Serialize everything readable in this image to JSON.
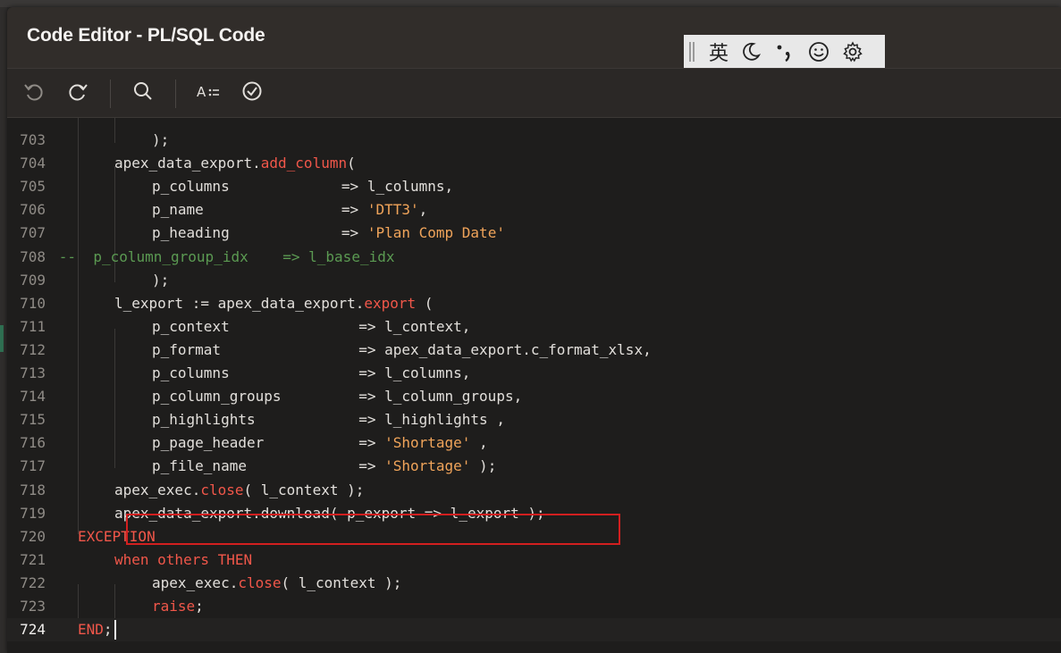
{
  "dialog": {
    "title": "Code Editor - PL/SQL Code"
  },
  "ime": {
    "mode_char": "英"
  },
  "toolbar": {
    "buttons": [
      {
        "name": "undo-button",
        "icon": "undo-icon"
      },
      {
        "name": "redo-button",
        "icon": "redo-icon"
      },
      {
        "name": "search-button",
        "icon": "search-icon"
      },
      {
        "name": "autocomplete-button",
        "icon": "autocomplete-icon"
      },
      {
        "name": "validate-button",
        "icon": "check-circle-icon"
      }
    ]
  },
  "editor": {
    "current_line": 724,
    "highlighted_line": 715,
    "lines": [
      {
        "n": "703",
        "indent": 3,
        "parts": [
          {
            "t": ");",
            "c": ""
          }
        ]
      },
      {
        "n": "704",
        "indent": 2,
        "parts": [
          {
            "t": "apex_data_export.",
            "c": ""
          },
          {
            "t": "add_column",
            "c": "fn"
          },
          {
            "t": "(",
            "c": ""
          }
        ]
      },
      {
        "n": "705",
        "indent": 3,
        "parts": [
          {
            "t": "p_columns             => l_columns,",
            "c": ""
          }
        ]
      },
      {
        "n": "706",
        "indent": 3,
        "parts": [
          {
            "t": "p_name                => ",
            "c": ""
          },
          {
            "t": "'DTT3'",
            "c": "str"
          },
          {
            "t": ",",
            "c": ""
          }
        ]
      },
      {
        "n": "707",
        "indent": 3,
        "parts": [
          {
            "t": "p_heading             => ",
            "c": ""
          },
          {
            "t": "'Plan Comp Date'",
            "c": "str"
          }
        ]
      },
      {
        "n": "708",
        "indent": 0,
        "parts": [
          {
            "t": "      --  p_column_group_idx    => l_base_idx",
            "c": "cmt"
          }
        ]
      },
      {
        "n": "709",
        "indent": 3,
        "parts": [
          {
            "t": ");",
            "c": ""
          }
        ]
      },
      {
        "n": "710",
        "indent": 2,
        "parts": [
          {
            "t": "l_export := apex_data_export.",
            "c": ""
          },
          {
            "t": "export",
            "c": "fn"
          },
          {
            "t": " (",
            "c": ""
          }
        ]
      },
      {
        "n": "711",
        "indent": 3,
        "parts": [
          {
            "t": "p_context               => l_context,",
            "c": ""
          }
        ]
      },
      {
        "n": "712",
        "indent": 3,
        "parts": [
          {
            "t": "p_format                => apex_data_export.c_format_xlsx,",
            "c": ""
          }
        ]
      },
      {
        "n": "713",
        "indent": 3,
        "parts": [
          {
            "t": "p_columns               => l_columns,",
            "c": ""
          }
        ]
      },
      {
        "n": "714",
        "indent": 3,
        "parts": [
          {
            "t": "p_column_groups         => l_column_groups,",
            "c": ""
          }
        ]
      },
      {
        "n": "715",
        "indent": 3,
        "parts": [
          {
            "t": "p_highlights            => l_highlights ,",
            "c": ""
          }
        ]
      },
      {
        "n": "716",
        "indent": 3,
        "parts": [
          {
            "t": "p_page_header           => ",
            "c": ""
          },
          {
            "t": "'Shortage'",
            "c": "str"
          },
          {
            "t": " ,",
            "c": ""
          }
        ]
      },
      {
        "n": "717",
        "indent": 3,
        "parts": [
          {
            "t": "p_file_name             => ",
            "c": ""
          },
          {
            "t": "'Shortage'",
            "c": "str"
          },
          {
            "t": " );",
            "c": ""
          }
        ]
      },
      {
        "n": "718",
        "indent": 2,
        "parts": [
          {
            "t": "apex_exec.",
            "c": ""
          },
          {
            "t": "close",
            "c": "fn"
          },
          {
            "t": "( l_context );",
            "c": ""
          }
        ]
      },
      {
        "n": "719",
        "indent": 2,
        "parts": [
          {
            "t": "apex_data_export.download( p_export => l_export );",
            "c": ""
          }
        ]
      },
      {
        "n": "720",
        "indent": 1,
        "parts": [
          {
            "t": "EXCEPTION",
            "c": "kw"
          }
        ]
      },
      {
        "n": "721",
        "indent": 2,
        "parts": [
          {
            "t": "when others THEN",
            "c": "kw"
          }
        ]
      },
      {
        "n": "722",
        "indent": 3,
        "parts": [
          {
            "t": "apex_exec.",
            "c": ""
          },
          {
            "t": "close",
            "c": "fn"
          },
          {
            "t": "( l_context );",
            "c": ""
          }
        ]
      },
      {
        "n": "723",
        "indent": 3,
        "parts": [
          {
            "t": "raise",
            "c": "kw"
          },
          {
            "t": ";",
            "c": ""
          }
        ]
      },
      {
        "n": "724",
        "indent": 1,
        "parts": [
          {
            "t": "END",
            "c": "kw"
          },
          {
            "t": ";",
            "c": ""
          }
        ]
      }
    ]
  },
  "colors": {
    "keyword": "#f1574a",
    "string": "#f0a45a",
    "comment": "#5b9a52",
    "text": "#e2dfdb",
    "annotation_box": "#d21f1f"
  }
}
